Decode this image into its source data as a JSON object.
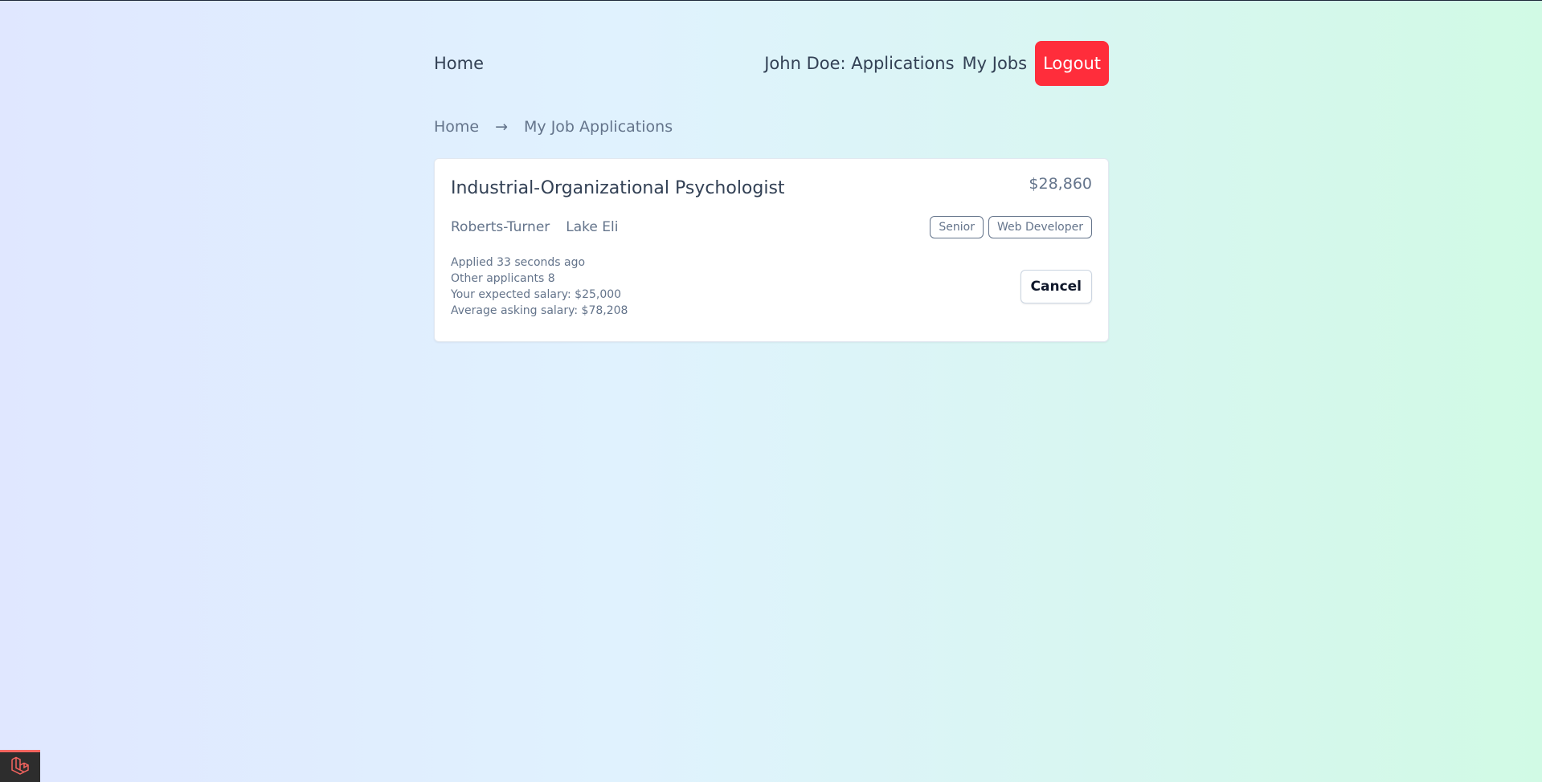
{
  "nav": {
    "home": "Home",
    "user_applications": "John Doe: Applications",
    "my_jobs": "My Jobs",
    "logout": "Logout"
  },
  "breadcrumb": {
    "home": "Home",
    "separator": "→",
    "current": "My Job Applications"
  },
  "application": {
    "title": "Industrial-Organizational Psychologist",
    "salary": "$28,860",
    "company": "Roberts-Turner",
    "location": "Lake Eli",
    "tags": [
      "Senior",
      "Web Developer"
    ],
    "applied": "Applied 33 seconds ago",
    "other_applicants": "Other applicants 8",
    "expected_salary": "Your expected salary: $25,000",
    "average_salary": "Average asking salary: $78,208",
    "cancel_label": "Cancel"
  },
  "colors": {
    "logout_bg": "#ff2d3b",
    "debugbar_bg": "#2d2d2d",
    "debugbar_accent": "#f4645f"
  }
}
